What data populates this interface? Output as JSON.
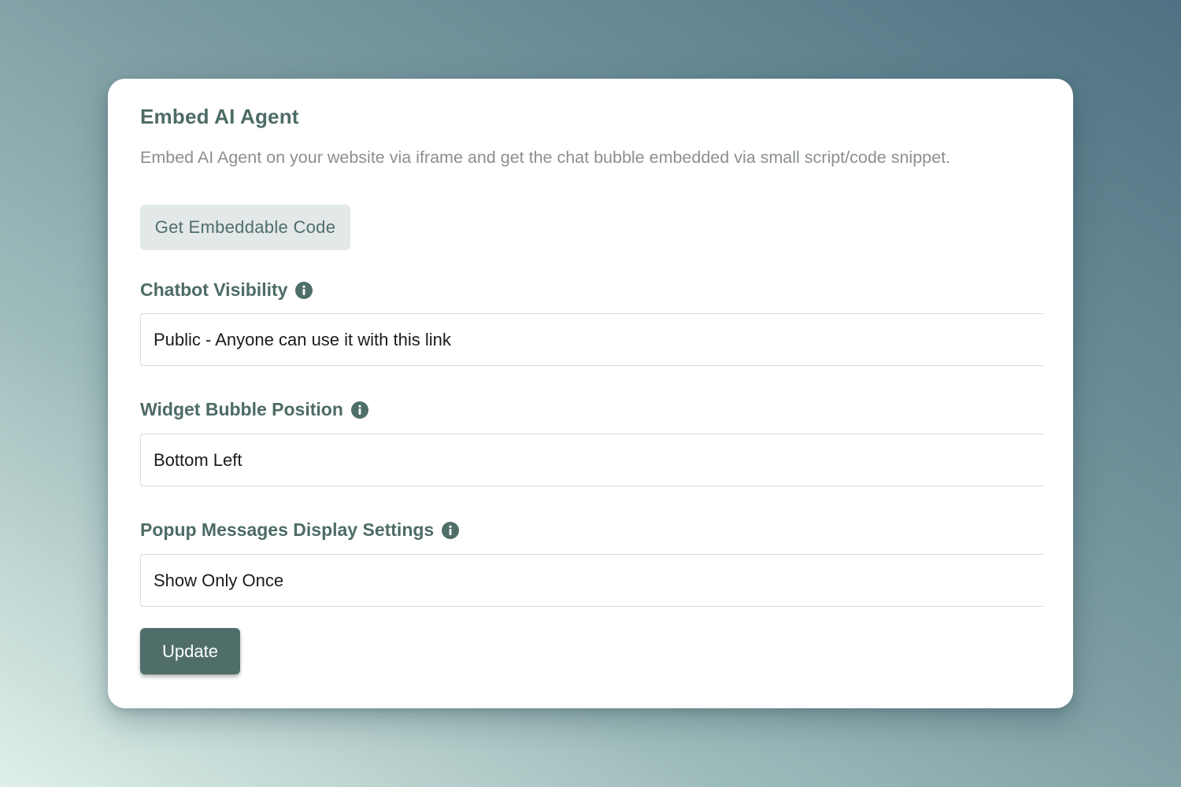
{
  "panel": {
    "title": "Embed AI Agent",
    "description": "Embed AI Agent on your website via iframe and get the chat bubble embedded via small script/code snippet.",
    "embed_button_label": "Get Embeddable Code"
  },
  "fields": {
    "visibility": {
      "label": "Chatbot Visibility",
      "icon": "info-icon",
      "value": "Public - Anyone can use it with this link"
    },
    "bubble_position": {
      "label": "Widget Bubble Position",
      "icon": "info-icon",
      "value": "Bottom Left"
    },
    "popup_display": {
      "label": "Popup Messages Display Settings",
      "icon": "info-icon",
      "value": "Show Only Once"
    }
  },
  "update_button_label": "Update",
  "colors": {
    "accent": "#4f6e69",
    "secondary_button_bg": "#e3e8e8",
    "description_text": "#8b8f90"
  }
}
